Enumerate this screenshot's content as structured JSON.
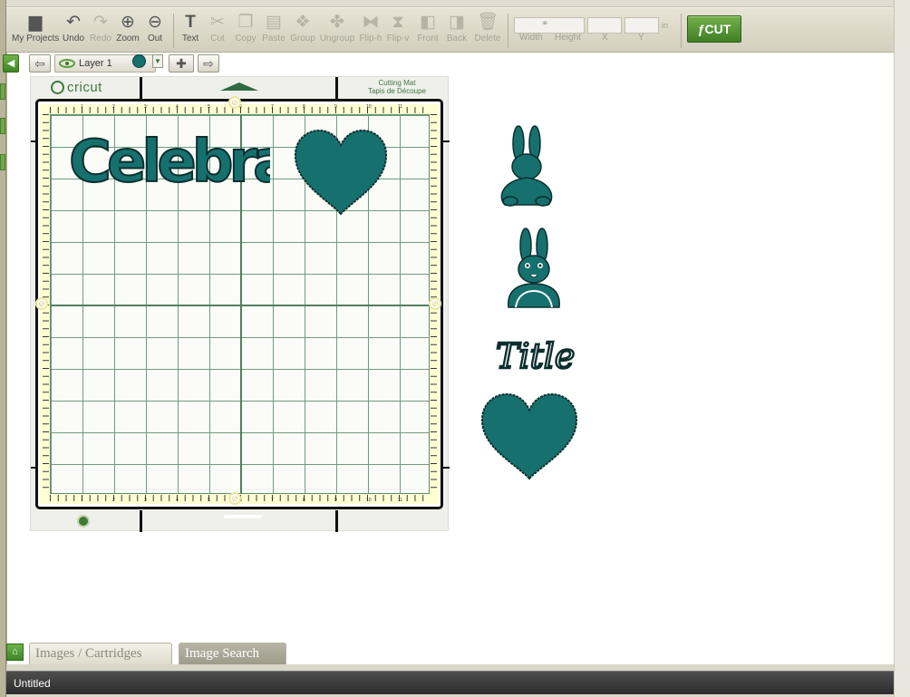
{
  "toolbar": {
    "tools": [
      {
        "id": "my-projects",
        "label": "My Projects",
        "icon": "folder-icon",
        "enabled": true
      },
      {
        "id": "undo",
        "label": "Undo",
        "icon": "undo-icon",
        "enabled": true
      },
      {
        "id": "redo",
        "label": "Redo",
        "icon": "redo-icon",
        "enabled": false
      },
      {
        "id": "zoom",
        "label": "Zoom",
        "icon": "zoom-in-icon",
        "enabled": true
      },
      {
        "id": "out",
        "label": "Out",
        "icon": "zoom-out-icon",
        "enabled": true
      },
      {
        "id": "text",
        "label": "Text",
        "icon": "text-icon",
        "enabled": true
      },
      {
        "id": "cut",
        "label": "Cut",
        "icon": "scissors-icon",
        "enabled": false
      },
      {
        "id": "copy",
        "label": "Copy",
        "icon": "copy-icon",
        "enabled": false
      },
      {
        "id": "paste",
        "label": "Paste",
        "icon": "paste-icon",
        "enabled": false
      },
      {
        "id": "group",
        "label": "Group",
        "icon": "group-icon",
        "enabled": false
      },
      {
        "id": "ungroup",
        "label": "Ungroup",
        "icon": "ungroup-icon",
        "enabled": false
      },
      {
        "id": "flip-h",
        "label": "Flip-h",
        "icon": "flip-horizontal-icon",
        "enabled": false
      },
      {
        "id": "flip-v",
        "label": "Flip-v",
        "icon": "flip-vertical-icon",
        "enabled": false
      },
      {
        "id": "front",
        "label": "Front",
        "icon": "bring-front-icon",
        "enabled": false
      },
      {
        "id": "back",
        "label": "Back",
        "icon": "send-back-icon",
        "enabled": false
      },
      {
        "id": "delete",
        "label": "Delete",
        "icon": "trash-icon",
        "enabled": false
      }
    ],
    "size_fields": {
      "width_label": "Width",
      "height_label": "Height",
      "x_label": "X",
      "y_label": "Y",
      "unit": "in"
    },
    "cut_button": "CUT"
  },
  "layer": {
    "name": "Layer 1",
    "color": "#16706e"
  },
  "mat": {
    "brand": "cricut",
    "title_line1": "Cutting Mat",
    "title_line2": "Tapis de Découpe",
    "top_numbers": [
      "1",
      "2",
      "3",
      "4",
      "5",
      "6",
      "7",
      "8",
      "9",
      "10",
      "11"
    ],
    "side_numbers": [
      "1",
      "2",
      "3",
      "4",
      "5",
      "6",
      "7",
      "8",
      "9",
      "10",
      "11"
    ]
  },
  "artwork": {
    "color": "#16706e",
    "celebrate_text": "Celebrate",
    "title_text": "Title"
  },
  "bottom_tabs": {
    "images": "Images / Cartridges",
    "search": "Image Search"
  },
  "status": {
    "title": "Untitled"
  }
}
